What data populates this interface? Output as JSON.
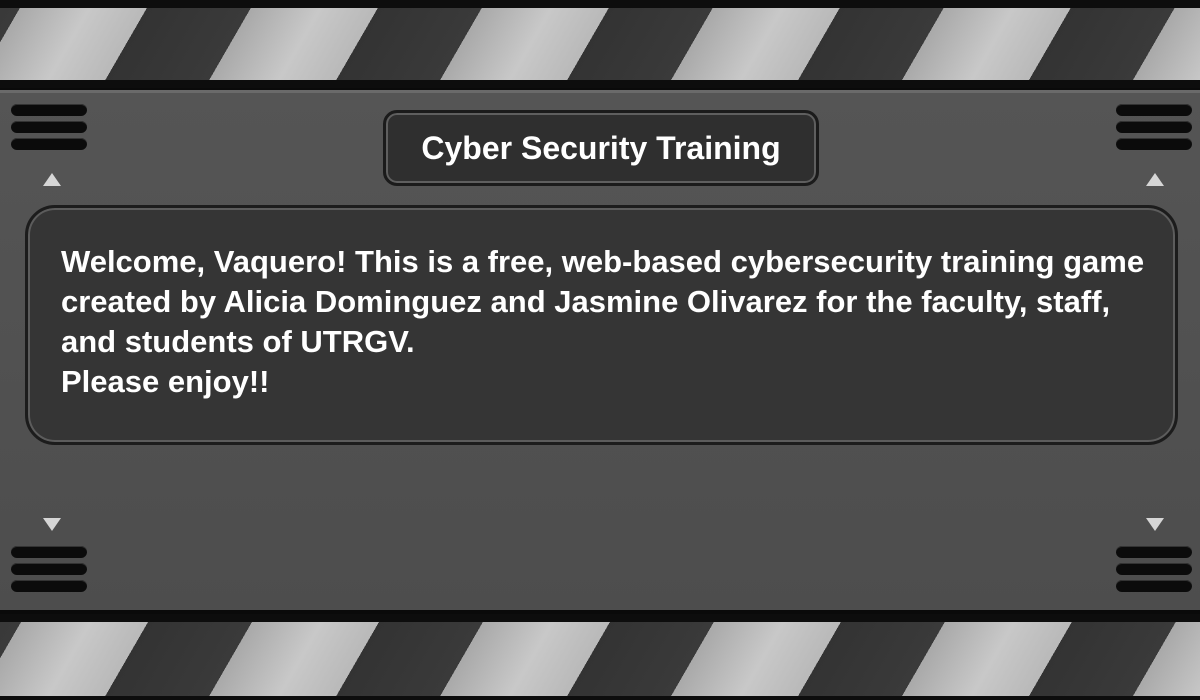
{
  "game": {
    "title": "Cyber Security Training",
    "message_lines": [
      "Welcome, Vaquero! This is a free, web-based cybersecurity training game created by Alicia Dominguez and Jasmine Olivarez for the faculty, staff, and students of UTRGV.",
      "Please enjoy!!"
    ]
  },
  "icons": {
    "scroll_up": "triangle-up-icon",
    "scroll_down": "triangle-down-icon",
    "vent": "vent-grille-icon"
  },
  "colors": {
    "panel": "#535353",
    "plate": "#2f2f2f",
    "text": "#ffffff",
    "stripe_light": "#c0c0c0",
    "stripe_dark": "#353535"
  }
}
